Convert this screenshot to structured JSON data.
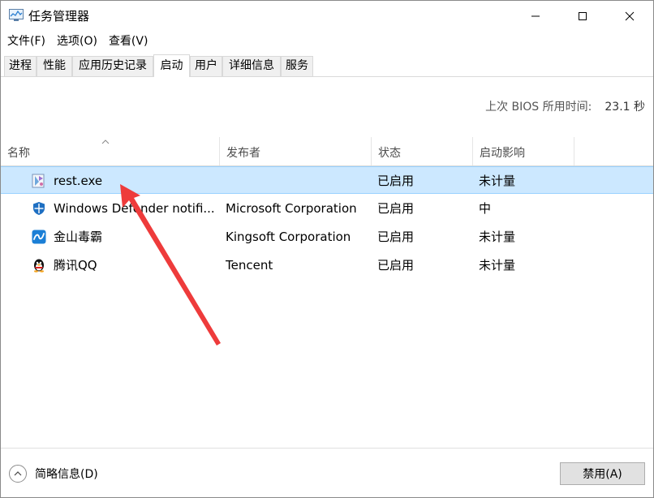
{
  "window": {
    "title": "任务管理器"
  },
  "menu": {
    "items": [
      "文件(F)",
      "选项(O)",
      "查看(V)"
    ]
  },
  "tabs": {
    "items": [
      "进程",
      "性能",
      "应用历史记录",
      "启动",
      "用户",
      "详细信息",
      "服务"
    ],
    "active": "启动"
  },
  "summary": {
    "bios_label": "上次 BIOS 所用时间:",
    "bios_value": "23.1 秒"
  },
  "table": {
    "columns": [
      "名称",
      "发布者",
      "状态",
      "启动影响"
    ],
    "rows": [
      {
        "icon": "rest-exe-icon",
        "name": "rest.exe",
        "publisher": "",
        "status": "已启用",
        "impact": "未计量"
      },
      {
        "icon": "windows-defender-icon",
        "name": "Windows Defender notifi...",
        "publisher": "Microsoft Corporation",
        "status": "已启用",
        "impact": "中"
      },
      {
        "icon": "kingsoft-antivirus-icon",
        "name": "金山毒霸",
        "publisher": "Kingsoft Corporation",
        "status": "已启用",
        "impact": "未计量"
      },
      {
        "icon": "qq-penguin-icon",
        "name": "腾讯QQ",
        "publisher": "Tencent",
        "status": "已启用",
        "impact": "未计量"
      }
    ]
  },
  "footer": {
    "brief_label": "简略信息(D)",
    "disable_label": "禁用(A)"
  },
  "colors": {
    "selection_bg": "#cce8ff",
    "selection_border": "#99d1ff",
    "arrow": "#ee3b3b"
  }
}
